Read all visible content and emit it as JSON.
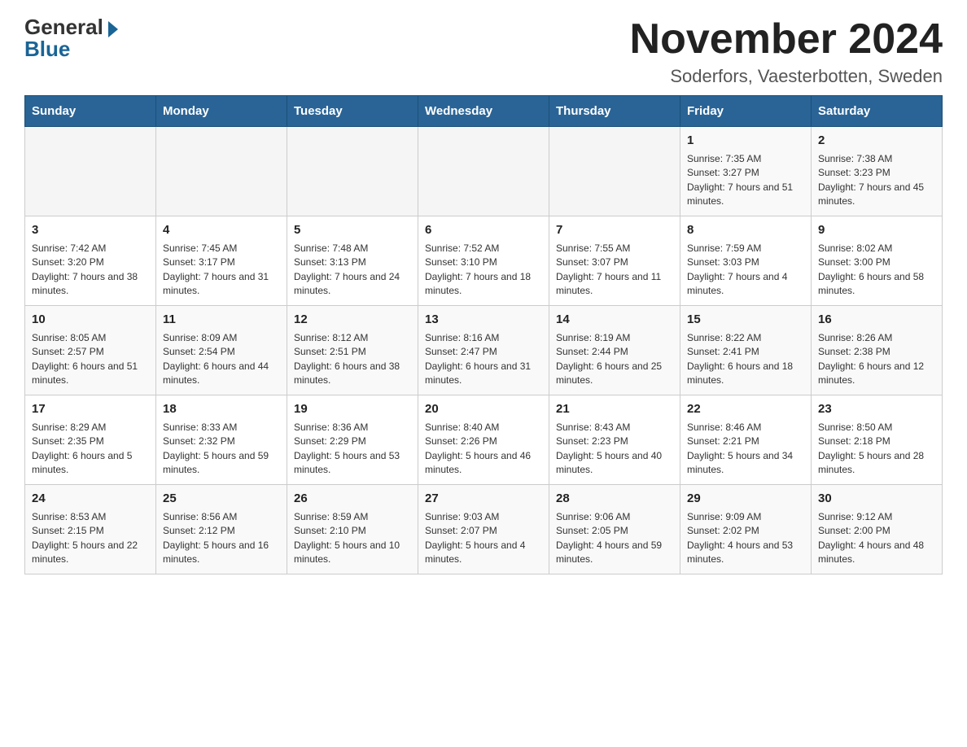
{
  "header": {
    "logo_general": "General",
    "logo_blue": "Blue",
    "month_title": "November 2024",
    "subtitle": "Soderfors, Vaesterbotten, Sweden"
  },
  "weekdays": [
    "Sunday",
    "Monday",
    "Tuesday",
    "Wednesday",
    "Thursday",
    "Friday",
    "Saturday"
  ],
  "weeks": [
    [
      {
        "day": "",
        "info": ""
      },
      {
        "day": "",
        "info": ""
      },
      {
        "day": "",
        "info": ""
      },
      {
        "day": "",
        "info": ""
      },
      {
        "day": "",
        "info": ""
      },
      {
        "day": "1",
        "info": "Sunrise: 7:35 AM\nSunset: 3:27 PM\nDaylight: 7 hours and 51 minutes."
      },
      {
        "day": "2",
        "info": "Sunrise: 7:38 AM\nSunset: 3:23 PM\nDaylight: 7 hours and 45 minutes."
      }
    ],
    [
      {
        "day": "3",
        "info": "Sunrise: 7:42 AM\nSunset: 3:20 PM\nDaylight: 7 hours and 38 minutes."
      },
      {
        "day": "4",
        "info": "Sunrise: 7:45 AM\nSunset: 3:17 PM\nDaylight: 7 hours and 31 minutes."
      },
      {
        "day": "5",
        "info": "Sunrise: 7:48 AM\nSunset: 3:13 PM\nDaylight: 7 hours and 24 minutes."
      },
      {
        "day": "6",
        "info": "Sunrise: 7:52 AM\nSunset: 3:10 PM\nDaylight: 7 hours and 18 minutes."
      },
      {
        "day": "7",
        "info": "Sunrise: 7:55 AM\nSunset: 3:07 PM\nDaylight: 7 hours and 11 minutes."
      },
      {
        "day": "8",
        "info": "Sunrise: 7:59 AM\nSunset: 3:03 PM\nDaylight: 7 hours and 4 minutes."
      },
      {
        "day": "9",
        "info": "Sunrise: 8:02 AM\nSunset: 3:00 PM\nDaylight: 6 hours and 58 minutes."
      }
    ],
    [
      {
        "day": "10",
        "info": "Sunrise: 8:05 AM\nSunset: 2:57 PM\nDaylight: 6 hours and 51 minutes."
      },
      {
        "day": "11",
        "info": "Sunrise: 8:09 AM\nSunset: 2:54 PM\nDaylight: 6 hours and 44 minutes."
      },
      {
        "day": "12",
        "info": "Sunrise: 8:12 AM\nSunset: 2:51 PM\nDaylight: 6 hours and 38 minutes."
      },
      {
        "day": "13",
        "info": "Sunrise: 8:16 AM\nSunset: 2:47 PM\nDaylight: 6 hours and 31 minutes."
      },
      {
        "day": "14",
        "info": "Sunrise: 8:19 AM\nSunset: 2:44 PM\nDaylight: 6 hours and 25 minutes."
      },
      {
        "day": "15",
        "info": "Sunrise: 8:22 AM\nSunset: 2:41 PM\nDaylight: 6 hours and 18 minutes."
      },
      {
        "day": "16",
        "info": "Sunrise: 8:26 AM\nSunset: 2:38 PM\nDaylight: 6 hours and 12 minutes."
      }
    ],
    [
      {
        "day": "17",
        "info": "Sunrise: 8:29 AM\nSunset: 2:35 PM\nDaylight: 6 hours and 5 minutes."
      },
      {
        "day": "18",
        "info": "Sunrise: 8:33 AM\nSunset: 2:32 PM\nDaylight: 5 hours and 59 minutes."
      },
      {
        "day": "19",
        "info": "Sunrise: 8:36 AM\nSunset: 2:29 PM\nDaylight: 5 hours and 53 minutes."
      },
      {
        "day": "20",
        "info": "Sunrise: 8:40 AM\nSunset: 2:26 PM\nDaylight: 5 hours and 46 minutes."
      },
      {
        "day": "21",
        "info": "Sunrise: 8:43 AM\nSunset: 2:23 PM\nDaylight: 5 hours and 40 minutes."
      },
      {
        "day": "22",
        "info": "Sunrise: 8:46 AM\nSunset: 2:21 PM\nDaylight: 5 hours and 34 minutes."
      },
      {
        "day": "23",
        "info": "Sunrise: 8:50 AM\nSunset: 2:18 PM\nDaylight: 5 hours and 28 minutes."
      }
    ],
    [
      {
        "day": "24",
        "info": "Sunrise: 8:53 AM\nSunset: 2:15 PM\nDaylight: 5 hours and 22 minutes."
      },
      {
        "day": "25",
        "info": "Sunrise: 8:56 AM\nSunset: 2:12 PM\nDaylight: 5 hours and 16 minutes."
      },
      {
        "day": "26",
        "info": "Sunrise: 8:59 AM\nSunset: 2:10 PM\nDaylight: 5 hours and 10 minutes."
      },
      {
        "day": "27",
        "info": "Sunrise: 9:03 AM\nSunset: 2:07 PM\nDaylight: 5 hours and 4 minutes."
      },
      {
        "day": "28",
        "info": "Sunrise: 9:06 AM\nSunset: 2:05 PM\nDaylight: 4 hours and 59 minutes."
      },
      {
        "day": "29",
        "info": "Sunrise: 9:09 AM\nSunset: 2:02 PM\nDaylight: 4 hours and 53 minutes."
      },
      {
        "day": "30",
        "info": "Sunrise: 9:12 AM\nSunset: 2:00 PM\nDaylight: 4 hours and 48 minutes."
      }
    ]
  ]
}
